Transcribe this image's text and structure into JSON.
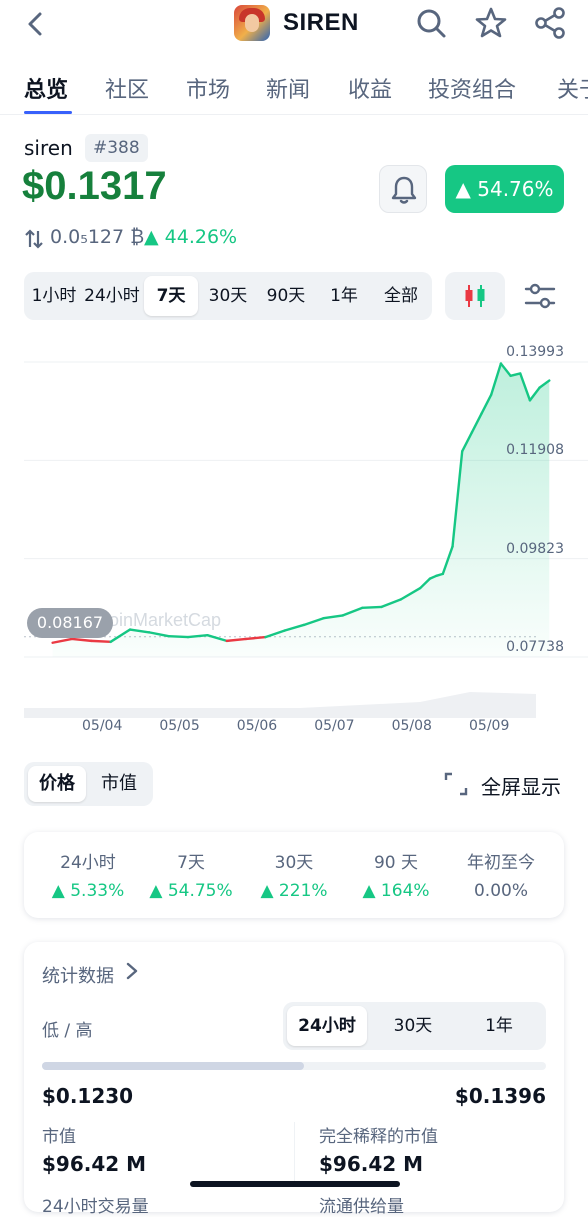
{
  "header": {
    "title": "SIREN",
    "icons": [
      "back-arrow-icon",
      "coin-logo",
      "search-icon",
      "star-icon",
      "share-icon"
    ]
  },
  "tabs": [
    {
      "label": "总览",
      "active": true
    },
    {
      "label": "社区"
    },
    {
      "label": "市场"
    },
    {
      "label": "新闻"
    },
    {
      "label": "收益"
    },
    {
      "label": "投资组合"
    },
    {
      "label": "关于"
    }
  ],
  "coin": {
    "name": "siren",
    "rank": "#388",
    "price": "$0.1317",
    "change_badge": "▲ 54.76%",
    "btc_price": "0.0₅127 ₿",
    "btc_change": "▲ 44.26%"
  },
  "range": {
    "options": [
      "1小时",
      "24小时",
      "7天",
      "30天",
      "90天",
      "1年",
      "全部"
    ],
    "selected": "7天"
  },
  "chart_data": {
    "type": "line",
    "title": "",
    "x_ticks": [
      "05/04",
      "05/05",
      "05/06",
      "05/07",
      "05/08",
      "05/09"
    ],
    "y_ticks": [
      0.13993,
      0.11908,
      0.09823,
      0.07738
    ],
    "ylim": [
      0.07738,
      0.13993
    ],
    "current_marker": "0.08167",
    "baseline": 0.08167,
    "watermark": "CoinMarketCap",
    "x": [
      "05/03 09:00",
      "05/03 15:00",
      "05/03 21:00",
      "05/04 03:00",
      "05/04 09:00",
      "05/04 15:00",
      "05/04 21:00",
      "05/05 03:00",
      "05/05 09:00",
      "05/05 15:00",
      "05/05 21:00",
      "05/06 03:00",
      "05/06 09:00",
      "05/06 15:00",
      "05/06 21:00",
      "05/07 03:00",
      "05/07 09:00",
      "05/07 15:00",
      "05/07 21:00",
      "05/08 03:00",
      "05/08 06:00",
      "05/08 08:00",
      "05/08 10:00",
      "05/08 13:00",
      "05/08 16:00",
      "05/08 19:00",
      "05/08 22:00",
      "05/09 01:00",
      "05/09 04:00",
      "05/09 07:00",
      "05/09 10:00",
      "05/09 13:00",
      "05/09 16:00",
      "05/09 19:00"
    ],
    "y": [
      0.0804,
      0.0812,
      0.0808,
      0.0806,
      0.0832,
      0.0826,
      0.0818,
      0.0816,
      0.082,
      0.0808,
      0.0812,
      0.0816,
      0.083,
      0.0842,
      0.0856,
      0.0862,
      0.0878,
      0.088,
      0.0896,
      0.092,
      0.094,
      0.0946,
      0.095,
      0.1008,
      0.121,
      0.125,
      0.129,
      0.133,
      0.1396,
      0.137,
      0.1375,
      0.1318,
      0.1345,
      0.136
    ]
  },
  "view_toggle": {
    "options": [
      "价格",
      "市值"
    ],
    "selected": "价格"
  },
  "fullscreen_label": "全屏显示",
  "performance": [
    {
      "label": "24小时",
      "value": "▲ 5.33%"
    },
    {
      "label": "7天",
      "value": "▲ 54.75%"
    },
    {
      "label": "30天",
      "value": "▲ 221%"
    },
    {
      "label": "90 天",
      "value": "▲ 164%"
    },
    {
      "label": "年初至今",
      "value": "0.00%"
    }
  ],
  "stats": {
    "title": "统计数据",
    "low_high_label": "低 / 高",
    "periods": [
      "24小时",
      "30天",
      "1年"
    ],
    "selected_period": "24小时",
    "range_position": 0.52,
    "low": "$0.1230",
    "high": "$0.1396",
    "market_cap_label": "市值",
    "market_cap": "$96.42 M",
    "fdv_label": "完全稀释的市值",
    "fdv": "$96.42 M",
    "volume_label": "24小时交易量",
    "supply_label": "流通供给量"
  },
  "colors": {
    "up": "#16c784",
    "down": "#ea3943",
    "accent": "#3861fb",
    "price": "#16803c"
  }
}
